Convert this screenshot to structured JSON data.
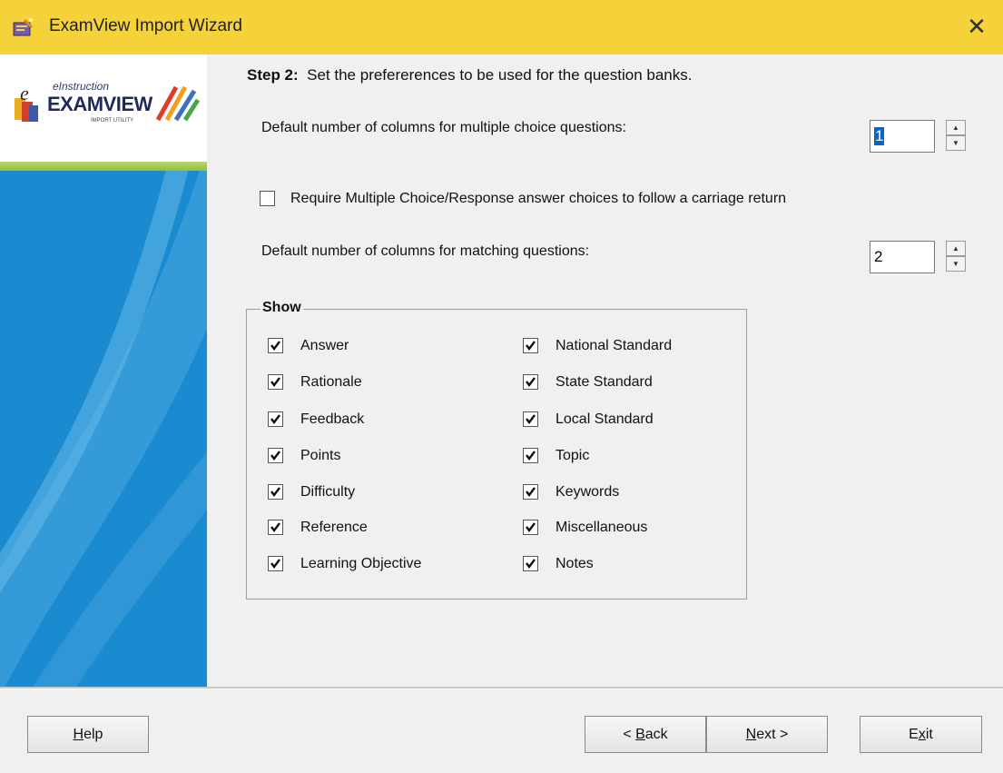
{
  "window": {
    "title": "ExamView Import Wizard",
    "close_glyph": "✕",
    "app_icon": "wizard-app-icon"
  },
  "sidebar": {
    "logo_line1": "eInstruction",
    "logo_line2": "EXAMVIEW",
    "logo_line3": "IMPORT UTILITY"
  },
  "step": {
    "label": "Step 2:",
    "text": "Set the prefererences to be used for the question banks."
  },
  "mc_columns": {
    "label": "Default number of columns for multiple choice questions:",
    "value": "1"
  },
  "carriage_return": {
    "label": "Require Multiple Choice/Response answer choices to follow a carriage return",
    "checked": false
  },
  "matching_columns": {
    "label": "Default number of columns for matching questions:",
    "value": "2"
  },
  "show": {
    "title": "Show",
    "left": [
      {
        "label": "Answer",
        "checked": true
      },
      {
        "label": "Rationale",
        "checked": true
      },
      {
        "label": "Feedback",
        "checked": true
      },
      {
        "label": "Points",
        "checked": true
      },
      {
        "label": "Difficulty",
        "checked": true
      },
      {
        "label": "Reference",
        "checked": true
      },
      {
        "label": "Learning Objective",
        "checked": true
      }
    ],
    "right": [
      {
        "label": "National Standard",
        "checked": true
      },
      {
        "label": "State Standard",
        "checked": true
      },
      {
        "label": "Local Standard",
        "checked": true
      },
      {
        "label": "Topic",
        "checked": true
      },
      {
        "label": "Keywords",
        "checked": true
      },
      {
        "label": "Miscellaneous",
        "checked": true
      },
      {
        "label": "Notes",
        "checked": true
      }
    ]
  },
  "buttons": {
    "help": {
      "pre": "",
      "u": "H",
      "post": "elp"
    },
    "back": {
      "pre": "< ",
      "u": "B",
      "post": "ack"
    },
    "next": {
      "pre": "",
      "u": "N",
      "post": "ext >"
    },
    "exit": {
      "pre": "E",
      "u": "x",
      "post": "it"
    }
  },
  "colors": {
    "titlebar": "#f5d23a",
    "sidebar": "#1a8bd0",
    "selection": "#0a63c9"
  }
}
